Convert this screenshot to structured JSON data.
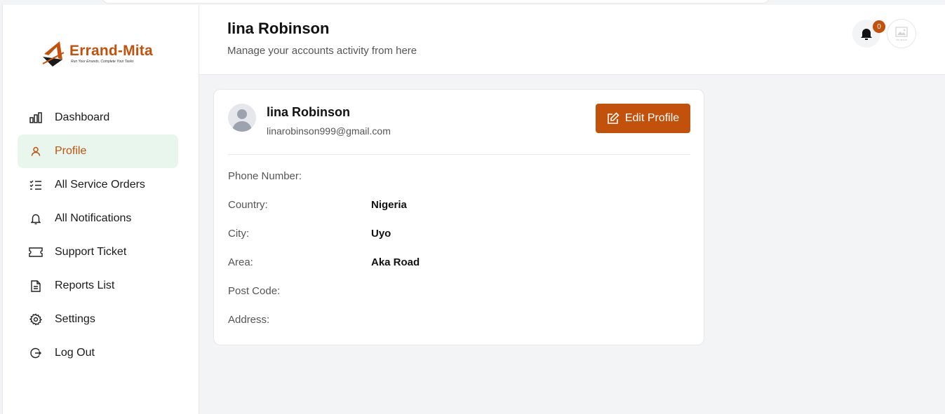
{
  "brand": {
    "name": "Errand-Mita",
    "tagline": "Run Your Errands, Complete Your Tasks",
    "accent": "#c2510c",
    "active_bg": "#e8f6ee"
  },
  "sidebar": {
    "items": [
      {
        "label": "Dashboard",
        "icon": "bar-chart-icon"
      },
      {
        "label": "Profile",
        "icon": "user-icon",
        "active": true
      },
      {
        "label": "All Service Orders",
        "icon": "checklist-icon"
      },
      {
        "label": "All Notifications",
        "icon": "bell-icon"
      },
      {
        "label": "Support Ticket",
        "icon": "ticket-icon"
      },
      {
        "label": "Reports List",
        "icon": "document-icon"
      },
      {
        "label": "Settings",
        "icon": "gear-icon"
      },
      {
        "label": "Log Out",
        "icon": "logout-icon"
      }
    ]
  },
  "header": {
    "title": "lina Robinson",
    "subtitle": "Manage your accounts activity from here",
    "notification_count": "0",
    "avatar_placeholder": "NO IMAGE"
  },
  "profile": {
    "name": "lina Robinson",
    "email": "linarobinson999@gmail.com",
    "edit_label": "Edit Profile",
    "fields": [
      {
        "label": "Phone Number:",
        "value": ""
      },
      {
        "label": "Country:",
        "value": "Nigeria"
      },
      {
        "label": "City:",
        "value": "Uyo"
      },
      {
        "label": "Area:",
        "value": "Aka Road"
      },
      {
        "label": "Post Code:",
        "value": ""
      },
      {
        "label": "Address:",
        "value": ""
      }
    ]
  }
}
